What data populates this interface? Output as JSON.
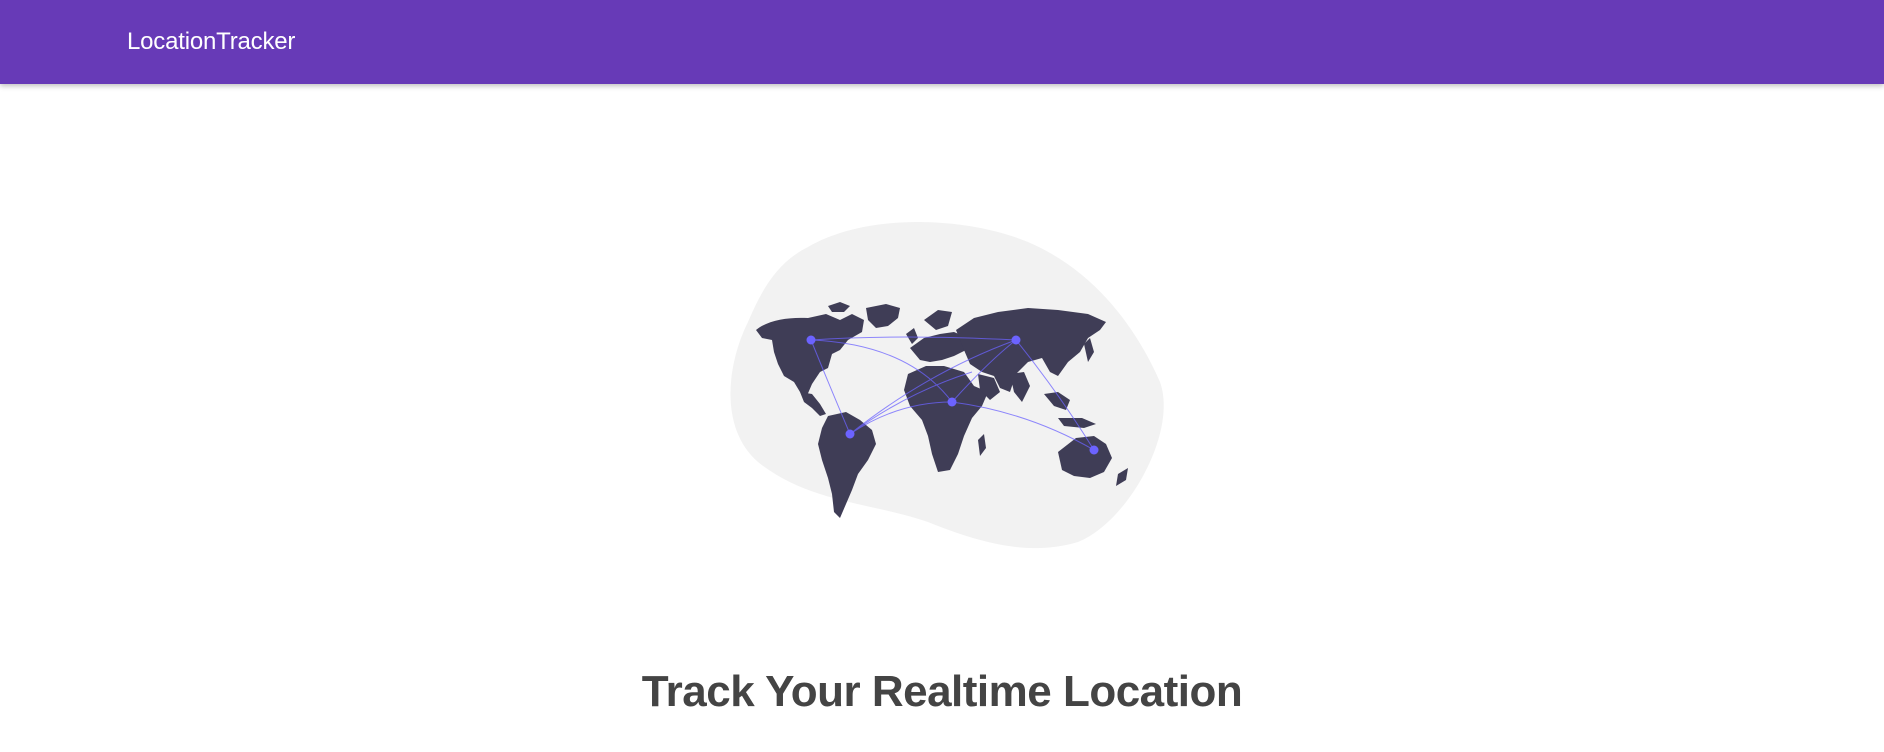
{
  "header": {
    "brand": "LocationTracker",
    "background": "#673ab7"
  },
  "hero": {
    "illustration": "world-map-network",
    "blob_color": "#f2f2f2",
    "continent_color": "#3f3d56",
    "accent_color": "#6c63ff",
    "headline": "Track Your Realtime Location"
  }
}
